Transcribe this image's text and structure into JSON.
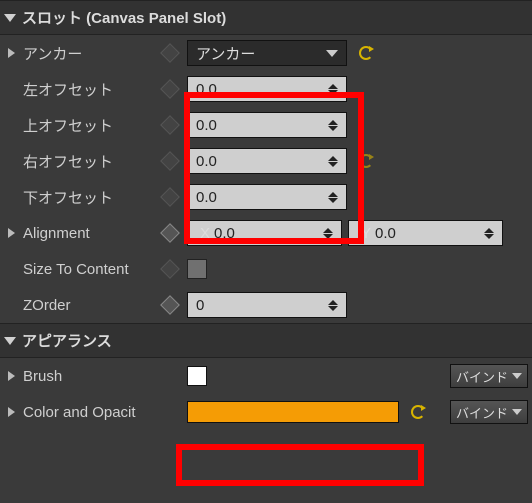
{
  "sections": {
    "slot": {
      "title": "スロット (Canvas Panel Slot)"
    },
    "appearance": {
      "title": "アピアランス"
    }
  },
  "slot": {
    "anchors": {
      "label": "アンカー",
      "combo": "アンカー"
    },
    "left": {
      "label": "左オフセット",
      "value": "0.0"
    },
    "top": {
      "label": "上オフセット",
      "value": "0.0"
    },
    "right": {
      "label": "右オフセット",
      "value": "0.0"
    },
    "bottom": {
      "label": "下オフセット",
      "value": "0.0"
    },
    "alignment": {
      "label": "Alignment",
      "x_label": "X",
      "x": "0.0",
      "y_label": "Y",
      "y": "0.0"
    },
    "sizeToContent": {
      "label": "Size To Content",
      "checked": false
    },
    "zorder": {
      "label": "ZOrder",
      "value": "0"
    }
  },
  "appearance": {
    "brush": {
      "label": "Brush",
      "color": "#ffffff"
    },
    "colorOpacity": {
      "label": "Color and Opacit",
      "color": "#f59c05"
    }
  },
  "buttons": {
    "bind": "バインド"
  }
}
